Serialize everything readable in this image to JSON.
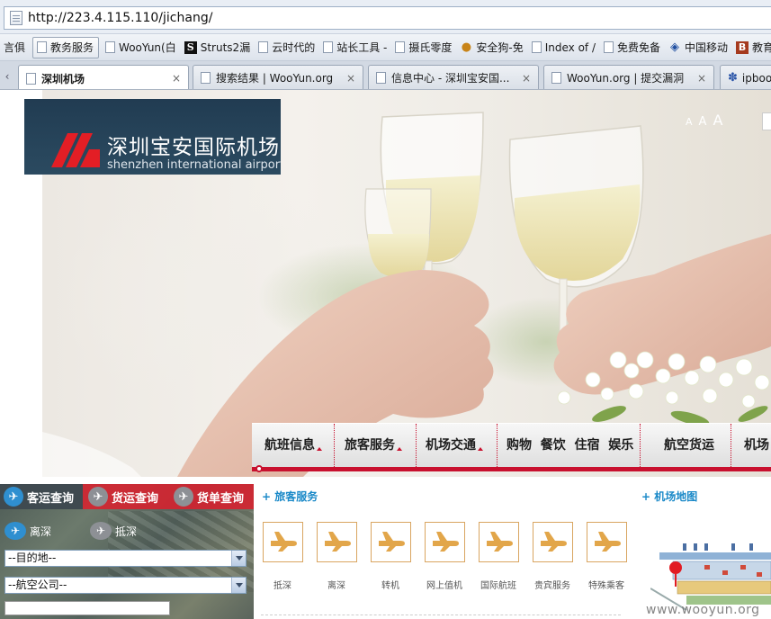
{
  "browser": {
    "address": "http://223.4.115.110/jichang/",
    "bookmarks": [
      {
        "label": "言俱",
        "icon": "none",
        "highlight": false
      },
      {
        "label": "教务服务",
        "icon": "doc-icon",
        "highlight": true
      },
      {
        "label": "WooYun(白",
        "icon": "doc-icon",
        "highlight": false
      },
      {
        "label": "Struts2漏",
        "icon": "s-icon",
        "highlight": false
      },
      {
        "label": "云时代的",
        "icon": "doc-icon",
        "highlight": false
      },
      {
        "label": "站长工具 -",
        "icon": "doc-icon",
        "highlight": false
      },
      {
        "label": "摄氏零度",
        "icon": "doc-icon",
        "highlight": false
      },
      {
        "label": "安全狗-免",
        "icon": "dog-icon",
        "highlight": false
      },
      {
        "label": "Index of /",
        "icon": "doc-icon",
        "highlight": false
      },
      {
        "label": "免费免备",
        "icon": "doc-icon",
        "highlight": false
      },
      {
        "label": "中国移动",
        "icon": "chinamobile-icon",
        "highlight": false
      },
      {
        "label": "教育网代",
        "icon": "edu-icon",
        "highlight": false
      }
    ],
    "tabs": [
      {
        "label": "深圳机场",
        "active": true
      },
      {
        "label": "搜索结果 | WooYun.org",
        "active": false
      },
      {
        "label": "信息中心 - 深圳宝安国...",
        "active": false
      },
      {
        "label": "WooYun.org | 提交漏洞",
        "active": false
      },
      {
        "label": "ipbook",
        "active": false
      }
    ],
    "tab_scroll_left": "‹",
    "tab_close": "×"
  },
  "header": {
    "logo_cn": "深圳宝安国际机场",
    "logo_en": "shenzhen international airport",
    "font_size_labels": [
      "A",
      "A",
      "A"
    ]
  },
  "nav": {
    "items": [
      "航班信息",
      "旅客服务",
      "机场交通",
      "购物  餐饮  住宿  娱乐",
      "航空货运",
      "机场"
    ]
  },
  "query": {
    "tabs": [
      "客运查询",
      "货运查询",
      "货单查询"
    ],
    "departure": "离深",
    "arrival": "抵深",
    "destination_select": "--目的地--",
    "airline_select": "--航空公司--"
  },
  "services": {
    "title": "+ 旅客服务",
    "items": [
      "抵深",
      "离深",
      "转机",
      "网上值机",
      "国际航班",
      "贵宾服务",
      "特殊乘客"
    ]
  },
  "map": {
    "title": "+ 机场地图"
  },
  "watermark": "www.wooyun.org",
  "colors": {
    "brand_red": "#c8102e",
    "section_blue": "#1a89c8",
    "logo_navy": "#213c52"
  }
}
